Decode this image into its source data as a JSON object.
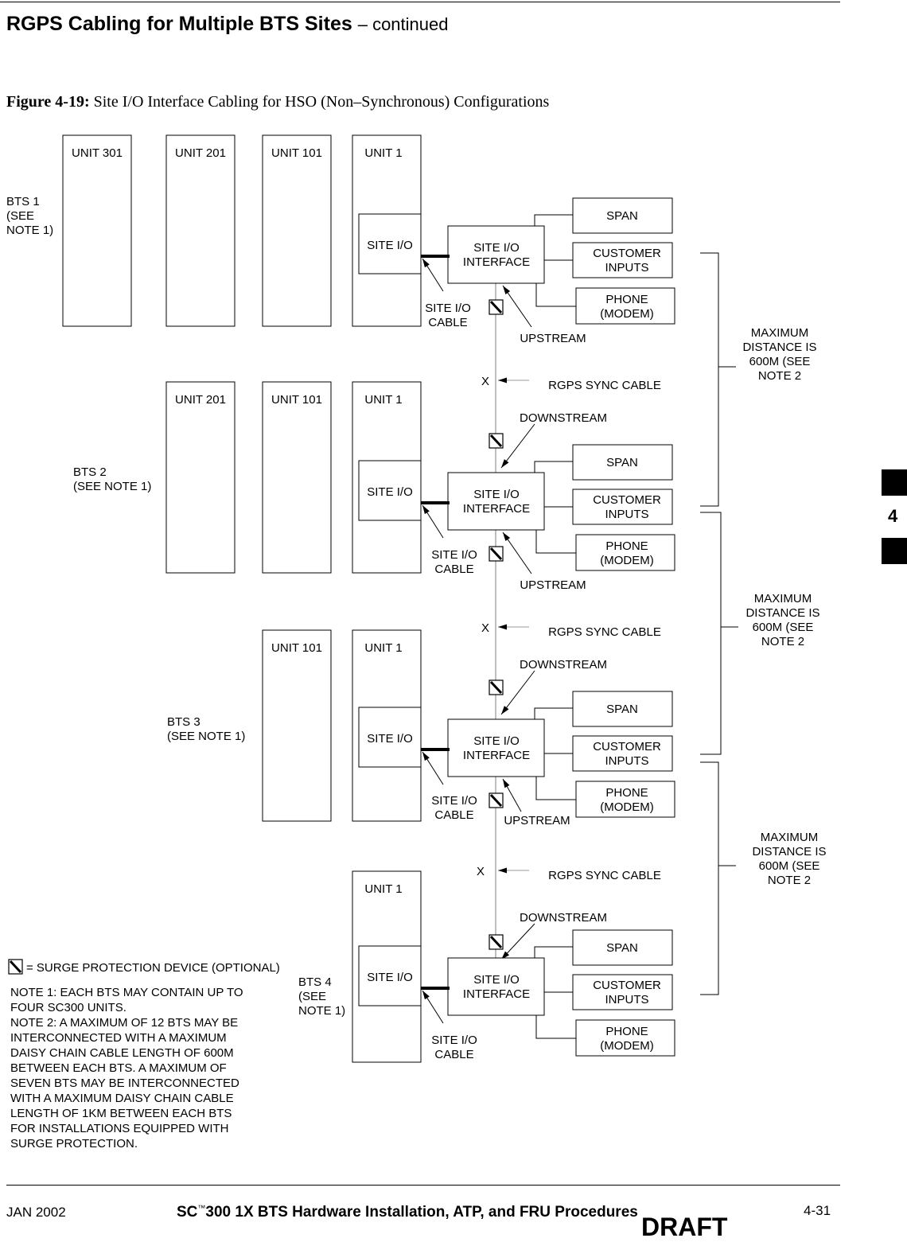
{
  "header": {
    "title": "RGPS Cabling for Multiple BTS Sites",
    "continued": "– continued"
  },
  "figure": {
    "number": "Figure 4-19:",
    "caption": "Site I/O Interface Cabling for HSO (Non–Synchronous) Configurations"
  },
  "bts_sites": [
    {
      "label": [
        "BTS 1",
        "(SEE",
        "NOTE 1)"
      ],
      "units": [
        "UNIT 301",
        "UNIT 201",
        "UNIT 101",
        "UNIT 1"
      ]
    },
    {
      "label": [
        "BTS 2",
        "(SEE NOTE 1)"
      ],
      "units": [
        "UNIT 201",
        "UNIT 101",
        "UNIT 1"
      ]
    },
    {
      "label": [
        "BTS 3",
        "(SEE NOTE 1)"
      ],
      "units": [
        "UNIT 101",
        "UNIT 1"
      ]
    },
    {
      "label": [
        "BTS 4",
        "(SEE",
        "NOTE 1)"
      ],
      "units": [
        "UNIT 1"
      ]
    }
  ],
  "labels": {
    "site_io": "SITE I/O",
    "interface": [
      "SITE I/O",
      "INTERFACE"
    ],
    "span": "SPAN",
    "customer": [
      "CUSTOMER",
      "INPUTS"
    ],
    "phone": [
      "PHONE",
      "(MODEM)"
    ],
    "site_io_cable": [
      "SITE I/O",
      "CABLE"
    ],
    "upstream": "UPSTREAM",
    "downstream": "DOWNSTREAM",
    "x_mark": "X",
    "rgps_sync_cable": "RGPS SYNC CABLE",
    "max_distance": [
      "MAXIMUM",
      "DISTANCE IS",
      "600M (SEE",
      "NOTE 2"
    ]
  },
  "legend": {
    "surge": "= SURGE PROTECTION DEVICE (OPTIONAL)",
    "surge_icon": "surge-protection-device-icon"
  },
  "notes": [
    "NOTE 1:  EACH BTS MAY CONTAIN UP TO",
    "FOUR SC300 UNITS.",
    "NOTE 2:  A MAXIMUM OF 12 BTS MAY BE",
    "INTERCONNECTED WITH A MAXIMUM",
    "DAISY CHAIN CABLE LENGTH OF 600M",
    "BETWEEN EACH BTS.  A MAXIMUM OF",
    "SEVEN BTS MAY BE INTERCONNECTED",
    "WITH A MAXIMUM DAISY CHAIN CABLE",
    "LENGTH OF 1KM BETWEEN EACH BTS",
    "FOR INSTALLATIONS EQUIPPED WITH",
    "SURGE PROTECTION."
  ],
  "footer": {
    "date": "JAN 2002",
    "title_prefix": "SC",
    "tm": "™",
    "title_rest": "300 1X BTS Hardware Installation, ATP, and FRU Procedures",
    "page": "4-31",
    "draft": "DRAFT"
  },
  "side_tab": {
    "chapter": "4"
  }
}
